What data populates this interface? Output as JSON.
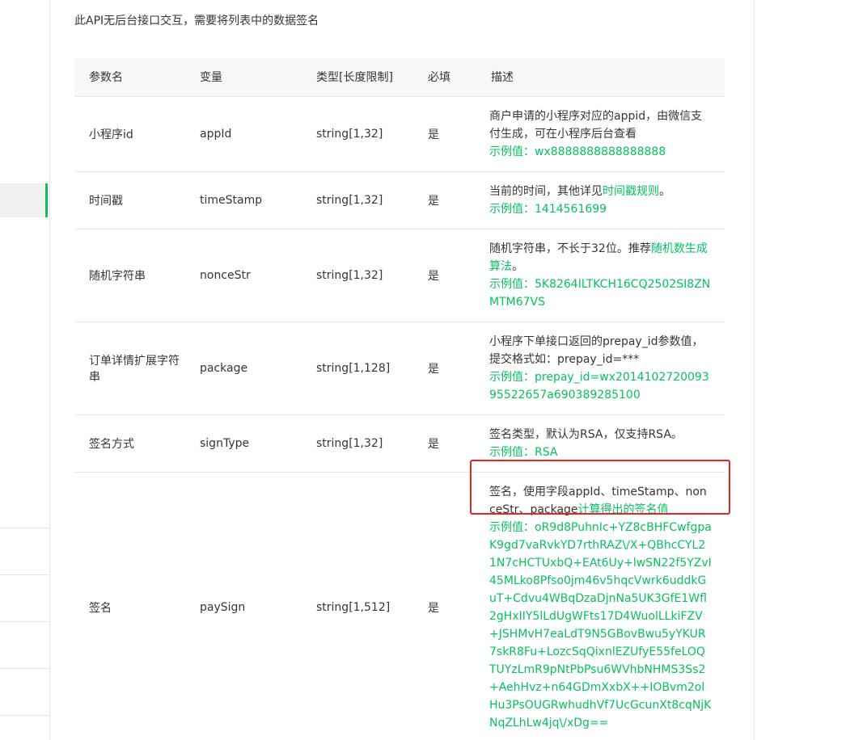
{
  "intro": "此API无后台接口交互，需要将列表中的数据签名",
  "headers": [
    "参数名",
    "变量",
    "类型[长度限制]",
    "必填",
    "描述"
  ],
  "rows": [
    {
      "name": "小程序id",
      "var": "appId",
      "type": "string[1,32]",
      "required": "是",
      "desc": "商户申请的小程序对应的appid，由微信支付生成，可在小程序后台查看",
      "link": "",
      "desc_after": "",
      "example": "示例值：wx8888888888888888"
    },
    {
      "name": "时间戳",
      "var": "timeStamp",
      "type": "string[1,32]",
      "required": "是",
      "desc": "当前的时间，其他详见",
      "link": "时间戳规则",
      "desc_after": "。",
      "example": "示例值：1414561699"
    },
    {
      "name": "随机字符串",
      "var": "nonceStr",
      "type": "string[1,32]",
      "required": "是",
      "desc": "随机字符串，不长于32位。推荐",
      "link": "随机数生成算法",
      "desc_after": "。",
      "example": "示例值：5K8264ILTKCH16CQ2502SI8ZNMTM67VS"
    },
    {
      "name": "订单详情扩展字符串",
      "var": "package",
      "type": "string[1,128]",
      "required": "是",
      "desc": "小程序下单接口返回的prepay_id参数值，提交格式如：prepay_id=***",
      "link": "",
      "desc_after": "",
      "example": "示例值：prepay_id=wx201410272009395522657a690389285100"
    },
    {
      "name": "签名方式",
      "var": "signType",
      "type": "string[1,32]",
      "required": "是",
      "desc": "签名类型，默认为RSA，仅支持RSA。",
      "link": "",
      "desc_after": "",
      "example": "示例值：RSA"
    },
    {
      "name": "签名",
      "var": "paySign",
      "type": "string[1,512]",
      "required": "是",
      "desc": "签名，使用字段appId、timeStamp、nonceStr、package",
      "link": "计算得出的签名值",
      "desc_after": "",
      "example": "示例值：oR9d8PuhnIc+YZ8cBHFCwfgpaK9gd7vaRvkYD7rthRAZ\\/X+QBhcCYL21N7cHCTUxbQ+EAt6Uy+lwSN22f5YZvI45MLko8Pfso0jm46v5hqcVwrk6uddkGuT+Cdvu4WBqDzaDjnNa5UK3GfE1Wfl2gHxIIY5lLdUgWFts17D4WuolLLkiFZV+JSHMvH7eaLdT9N5GBovBwu5yYKUR7skR8Fu+LozcSqQixnlEZUfyE55feLOQTUYzLmR9pNtPbPsu6WVhbNHMS3Ss2+AehHvz+n64GDmXxbX++IOBvm2olHu3PsOUGRwhudhVf7UcGcunXt8cqNjKNqZLhLw4jq\\/xDg=="
    }
  ]
}
